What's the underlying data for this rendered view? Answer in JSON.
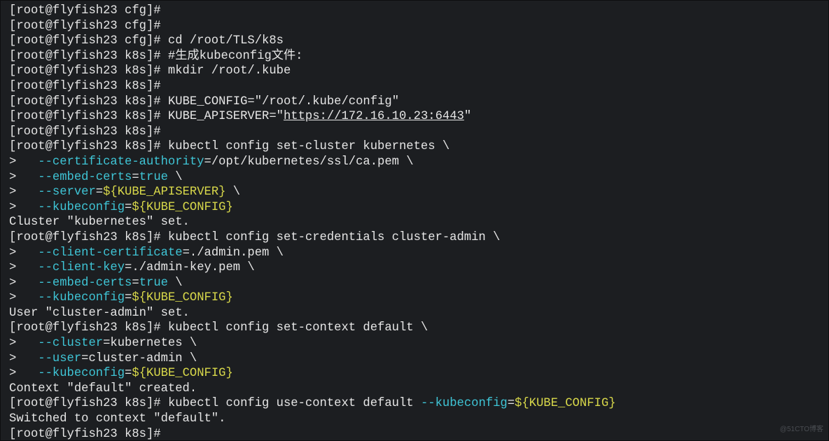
{
  "watermark": "@51CTO博客",
  "prompt": {
    "user": "root",
    "host": "flyfish23",
    "dir_cfg": "cfg",
    "dir_k8s": "k8s",
    "cont": ">   "
  },
  "lines": [
    {
      "type": "prompt",
      "dir": "cfg",
      "cmd": ""
    },
    {
      "type": "prompt",
      "dir": "cfg",
      "cmd": ""
    },
    {
      "type": "prompt",
      "dir": "cfg",
      "cmd": "cd /root/TLS/k8s"
    },
    {
      "type": "prompt",
      "dir": "k8s",
      "cmd": "#生成kubeconfig文件:"
    },
    {
      "type": "prompt",
      "dir": "k8s",
      "cmd": "mkdir /root/.kube"
    },
    {
      "type": "prompt",
      "dir": "k8s",
      "cmd": ""
    },
    {
      "type": "kv",
      "dir": "k8s",
      "pre": "KUBE_CONFIG=",
      "val": "\"/root/.kube/config\""
    },
    {
      "type": "kv",
      "dir": "k8s",
      "pre": "KUBE_APISERVER=\"",
      "url": "https://172.16.10.23:6443",
      "post": "\""
    },
    {
      "type": "prompt",
      "dir": "k8s",
      "cmd": ""
    },
    {
      "type": "prompt",
      "dir": "k8s",
      "cmd": "kubectl config set-cluster kubernetes \\"
    },
    {
      "type": "flag",
      "flag": "--certificate-authority",
      "eq": "=",
      "val": "/opt/kubernetes/ssl/ca.pem \\",
      "valcolor": "g"
    },
    {
      "type": "flag",
      "flag": "--embed-certs",
      "eq": "=",
      "val": "true",
      "tail": " \\",
      "valcolor": "c"
    },
    {
      "type": "flag",
      "flag": "--server",
      "eq": "=",
      "val": "${KUBE_APISERVER}",
      "tail": " \\",
      "valcolor": "y"
    },
    {
      "type": "flag",
      "flag": "--kubeconfig",
      "eq": "=",
      "val": "${KUBE_CONFIG}",
      "valcolor": "y"
    },
    {
      "type": "out",
      "text": "Cluster \"kubernetes\" set."
    },
    {
      "type": "prompt",
      "dir": "k8s",
      "cmd": "kubectl config set-credentials cluster-admin \\"
    },
    {
      "type": "flag",
      "flag": "--client-certificate",
      "eq": "=",
      "val": "./admin.pem \\",
      "valcolor": "g"
    },
    {
      "type": "flag",
      "flag": "--client-key",
      "eq": "=",
      "val": "./admin-key.pem \\",
      "valcolor": "g"
    },
    {
      "type": "flag",
      "flag": "--embed-certs",
      "eq": "=",
      "val": "true",
      "tail": " \\",
      "valcolor": "c"
    },
    {
      "type": "flag",
      "flag": "--kubeconfig",
      "eq": "=",
      "val": "${KUBE_CONFIG}",
      "valcolor": "y"
    },
    {
      "type": "out",
      "text": "User \"cluster-admin\" set."
    },
    {
      "type": "prompt",
      "dir": "k8s",
      "cmd": "kubectl config set-context default \\"
    },
    {
      "type": "flag",
      "flag": "--cluster",
      "eq": "=",
      "val": "kubernetes \\",
      "valcolor": "g"
    },
    {
      "type": "flag",
      "flag": "--user",
      "eq": "=",
      "val": "cluster-admin \\",
      "valcolor": "g"
    },
    {
      "type": "flag",
      "flag": "--kubeconfig",
      "eq": "=",
      "val": "${KUBE_CONFIG}",
      "valcolor": "y"
    },
    {
      "type": "out",
      "text": "Context \"default\" created."
    },
    {
      "type": "usectx",
      "dir": "k8s",
      "pre": "kubectl config use-context default ",
      "flag": "--kubeconfig",
      "eq": "=",
      "val": "${KUBE_CONFIG}"
    },
    {
      "type": "out",
      "text": "Switched to context \"default\"."
    },
    {
      "type": "prompt",
      "dir": "k8s",
      "cmd": ""
    }
  ]
}
